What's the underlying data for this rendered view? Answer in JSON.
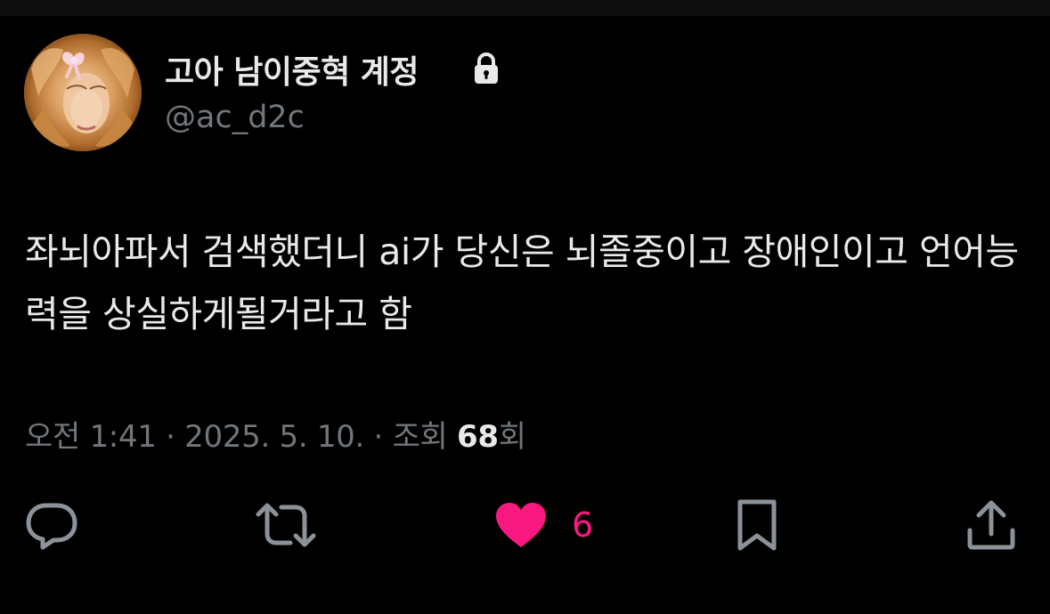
{
  "account": {
    "display_name": "고아 남이중혁 계정",
    "handle": "@ac_d2c",
    "protected_icon": "lock-icon",
    "avatar_icon": "profile-avatar"
  },
  "tweet": {
    "text": "좌뇌아파서 검색했더니 ai가 당신은 뇌졸중이고 장애인이고 언어능력을 상실하게될거라고 함",
    "time": "오전 1:41",
    "separator": " · ",
    "date": "2025. 5. 10.",
    "views_label_prefix": "조회 ",
    "views_count": "68",
    "views_label_suffix": "회"
  },
  "actions": {
    "reply_icon": "reply-icon",
    "retweet_icon": "retweet-icon",
    "like_icon": "heart-icon",
    "like_count": "6",
    "bookmark_icon": "bookmark-icon",
    "share_icon": "share-icon"
  },
  "colors": {
    "background": "#000000",
    "text_primary": "#e7e9ea",
    "text_secondary": "#71767b",
    "like_active": "#f91880"
  }
}
